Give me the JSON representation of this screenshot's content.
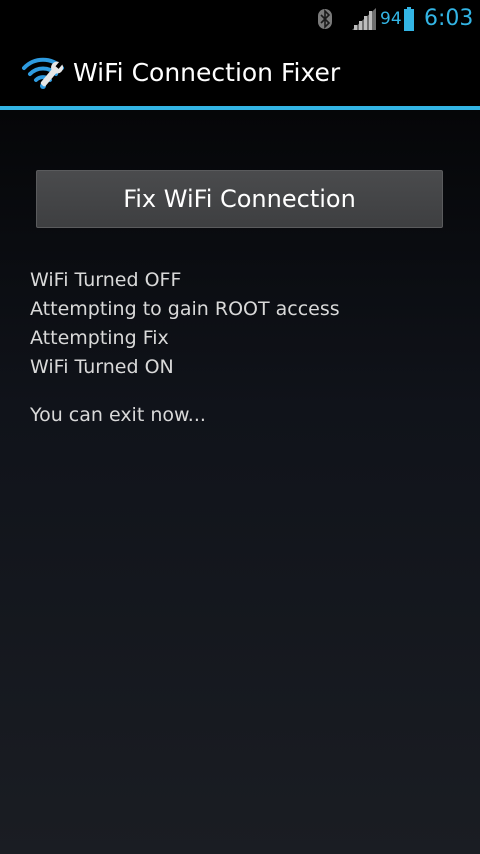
{
  "status_bar": {
    "battery_level": "94",
    "time": "6:03",
    "icons": [
      "bluetooth-icon",
      "signal-icon",
      "battery-icon"
    ],
    "accent_color": "#33b5e5"
  },
  "action_bar": {
    "title": "WiFi Connection Fixer",
    "icon": "wifi-wrench-icon"
  },
  "main": {
    "fix_button_label": "Fix WiFi Connection",
    "log": [
      "WiFi Turned OFF",
      "Attempting to gain ROOT access",
      "Attempting Fix",
      "WiFi Turned ON"
    ],
    "exit_message": "You can exit now..."
  }
}
